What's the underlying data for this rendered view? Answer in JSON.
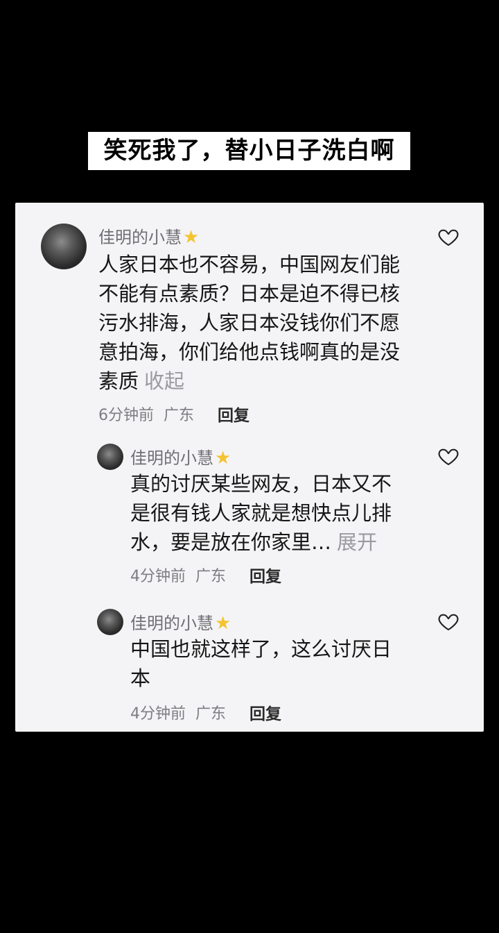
{
  "caption": "笑死我了，替小日子洗白啊",
  "comments": [
    {
      "username": "佳明的小慧",
      "star": "★",
      "text": "人家日本也不容易，中国网友们能不能有点素质？日本是迫不得已核污水排海，人家日本没钱你们不愿意拍海，你们给他点钱啊真的是没素质",
      "toggle": "收起",
      "time": "6分钟前",
      "location": "广东",
      "reply": "回复",
      "like_icon": "heart-outline-icon"
    },
    {
      "username": "佳明的小慧",
      "star": "★",
      "text": "真的讨厌某些网友，日本又不是很有钱人家就是想快点儿排水，要是放在你家里…",
      "toggle": "展开",
      "time": "4分钟前",
      "location": "广东",
      "reply": "回复",
      "like_icon": "heart-outline-icon"
    },
    {
      "username": "佳明的小慧",
      "star": "★",
      "text": "中国也就这样了，这么讨厌日本",
      "toggle": "",
      "time": "4分钟前",
      "location": "广东",
      "reply": "回复",
      "like_icon": "heart-outline-icon"
    }
  ]
}
